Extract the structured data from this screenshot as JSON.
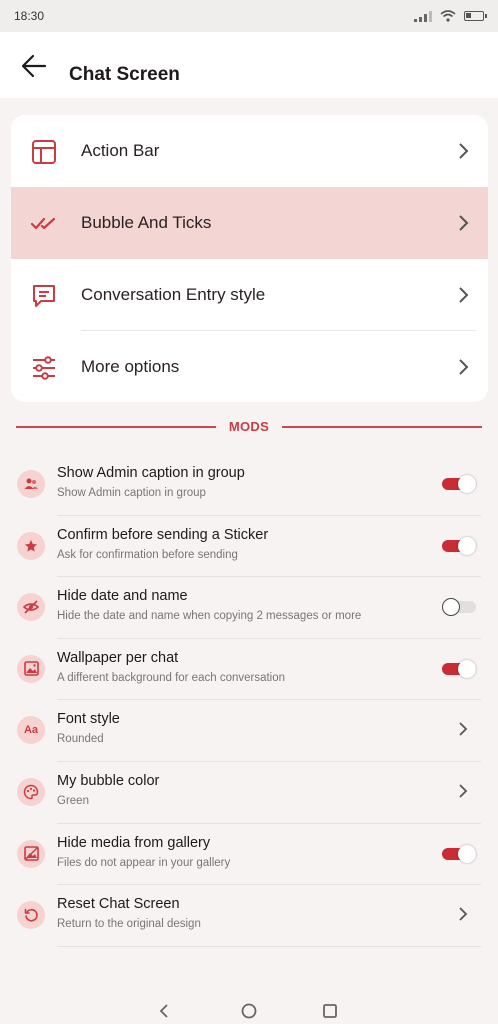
{
  "status_bar": {
    "time": "18:30"
  },
  "header": {
    "title": "Chat Screen"
  },
  "menu": [
    {
      "label": "Action Bar",
      "icon": "layout-icon",
      "active": false
    },
    {
      "label": "Bubble And Ticks",
      "icon": "double-check-icon",
      "active": true
    },
    {
      "label": "Conversation Entry style",
      "icon": "chat-message-icon",
      "active": false
    },
    {
      "label": "More options",
      "icon": "sliders-icon",
      "active": false
    }
  ],
  "mods_label": "MODS",
  "mods": [
    {
      "title": "Show Admin caption in group",
      "subtitle": "Show Admin caption in group",
      "icon": "users-icon",
      "control": "toggle",
      "value": true
    },
    {
      "title": "Confirm before sending a Sticker",
      "subtitle": "Ask for confirmation before sending",
      "icon": "star-icon",
      "control": "toggle",
      "value": true
    },
    {
      "title": "Hide date and name",
      "subtitle": "Hide the date and name when copying 2 messages or more",
      "icon": "eye-off-icon",
      "control": "toggle",
      "value": false
    },
    {
      "title": "Wallpaper per chat",
      "subtitle": "A different background for each conversation",
      "icon": "image-icon",
      "control": "toggle",
      "value": true
    },
    {
      "title": "Font style",
      "subtitle": "Rounded",
      "icon": "font-icon",
      "icon_text": "Aa",
      "control": "chevron"
    },
    {
      "title": "My bubble color",
      "subtitle": "Green",
      "icon": "palette-icon",
      "control": "chevron"
    },
    {
      "title": "Hide media from gallery",
      "subtitle": "Files do not appear in your gallery",
      "icon": "gallery-off-icon",
      "control": "toggle",
      "value": true
    },
    {
      "title": "Reset Chat Screen",
      "subtitle": "Return to the original design",
      "icon": "reset-icon",
      "control": "chevron"
    }
  ],
  "colors": {
    "accent": "#c92c34",
    "active_row": "#f3d5d3",
    "icon_bg": "#f6d2d0"
  }
}
